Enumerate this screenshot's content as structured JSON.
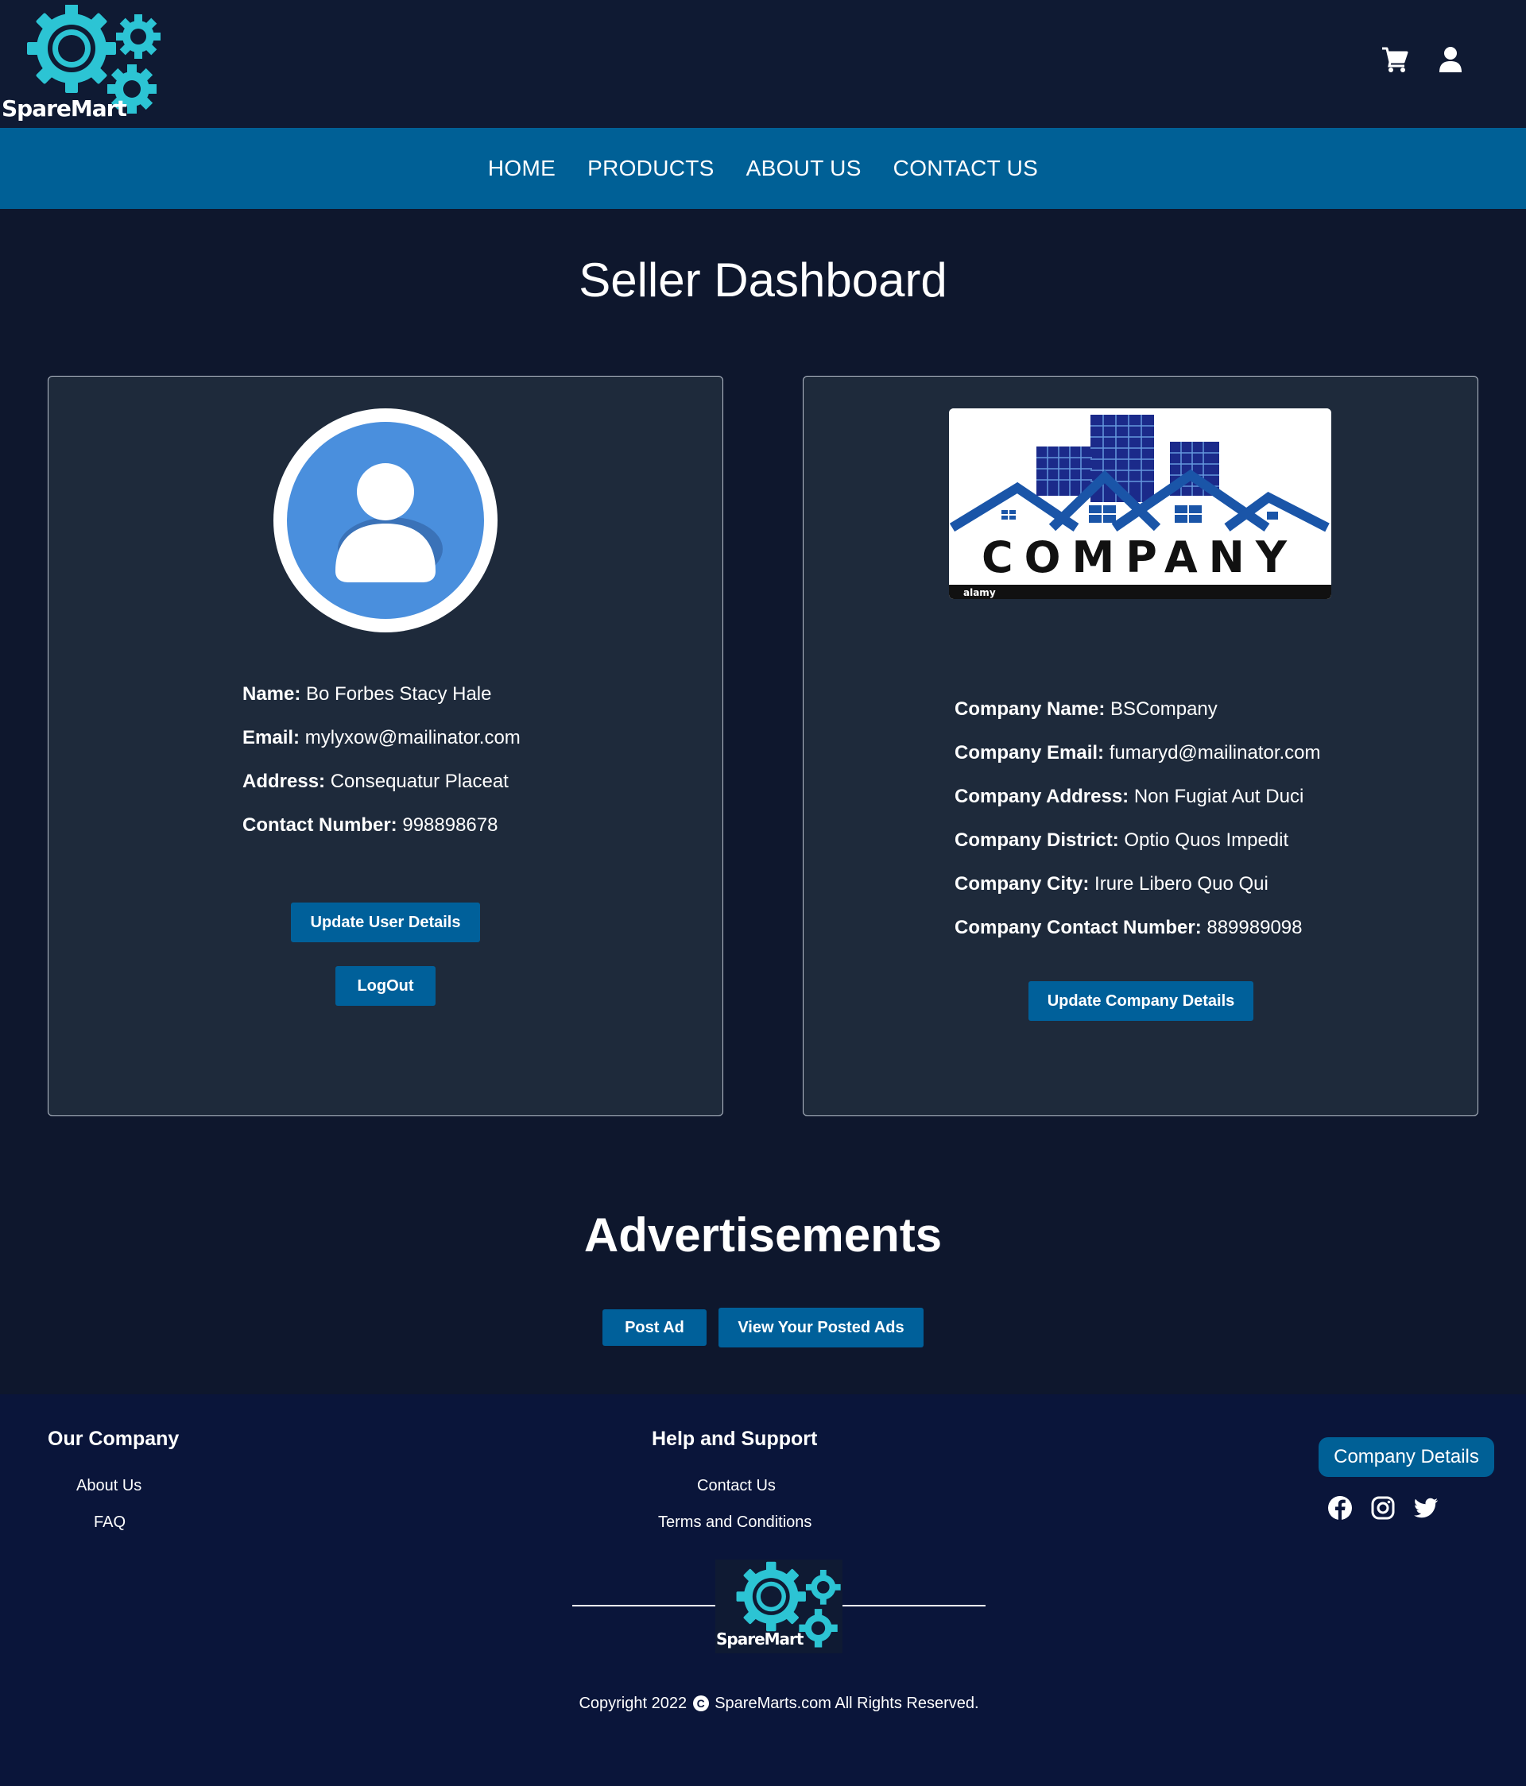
{
  "header": {
    "logo_text": "SpareMart",
    "cart_icon": "cart-icon",
    "user_icon": "user-icon"
  },
  "nav": {
    "items": [
      "HOME",
      "PRODUCTS",
      "ABOUT US",
      "CONTACT US"
    ]
  },
  "page_title": "Seller Dashboard",
  "user": {
    "avatar_icon": "user-avatar-icon",
    "name_label": "Name:",
    "name": "Bo Forbes Stacy Hale",
    "email_label": "Email:",
    "email": "mylyxow@mailinator.com",
    "address_label": "Address:",
    "address": "Consequatur Placeat",
    "contact_label": "Contact Number:",
    "contact": "998898678",
    "update_button": "Update User Details",
    "logout_button": "LogOut"
  },
  "company": {
    "logo_text": "COMPANY",
    "logo_watermark": "alamy",
    "name_label": "Company Name:",
    "name": "BSCompany",
    "email_label": "Company Email:",
    "email": "fumaryd@mailinator.com",
    "address_label": "Company Address:",
    "address": "Non Fugiat Aut Duci",
    "district_label": "Company District:",
    "district": "Optio Quos Impedit",
    "city_label": "Company City:",
    "city": "Irure Libero Quo Qui",
    "contact_label": "Company Contact Number:",
    "contact": "889989098",
    "update_button": "Update Company Details"
  },
  "ads": {
    "title": "Advertisements",
    "post_button": "Post Ad",
    "view_button": "View Your Posted Ads"
  },
  "footer": {
    "our_company_title": "Our Company",
    "our_company_links": [
      "About Us",
      "FAQ"
    ],
    "help_title": "Help and Support",
    "help_links": [
      "Contact Us",
      "Terms and Conditions"
    ],
    "company_details_button": "Company Details",
    "socials": [
      "facebook-icon",
      "instagram-icon",
      "twitter-icon"
    ],
    "logo_text": "SpareMart",
    "copyright_pre": "Copyright 2022",
    "copyright_post": "SpareMarts.com All Rights Reserved."
  },
  "colors": {
    "page_bg": "#0e172d",
    "nav_bg": "#006096",
    "card_bg": "#1e2a3b",
    "button": "#00609a",
    "footer_bg": "#0a153a",
    "logo_teal": "#2cc4d4"
  }
}
